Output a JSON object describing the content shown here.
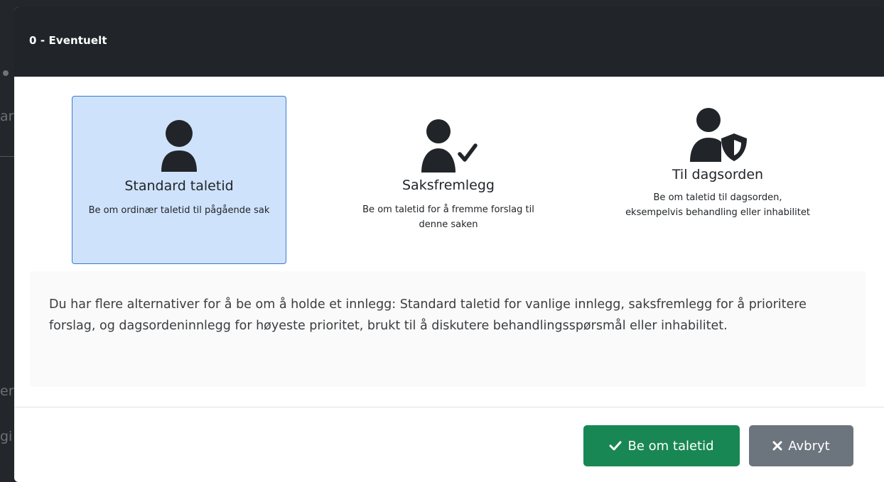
{
  "background": {
    "fragments": [
      "ar",
      "er",
      "gi"
    ]
  },
  "modal": {
    "title": "0 - Eventuelt"
  },
  "options": [
    {
      "icon": "user-icon",
      "title": "Standard taletid",
      "description": "Be om ordinær taletid til pågående sak",
      "selected": true
    },
    {
      "icon": "user-check-icon",
      "title": "Saksfremlegg",
      "description": "Be om taletid for å fremme forslag til denne saken",
      "selected": false
    },
    {
      "icon": "user-shield-icon",
      "title": "Til dagsorden",
      "description": "Be om taletid til dagsorden, eksempelvis behandling eller inhabilitet",
      "selected": false
    }
  ],
  "info": {
    "text": "Du har flere alternativer for å be om å holde et innlegg: Standard taletid for vanlige innlegg, saksfremlegg for å prioritere forslag, og dagsordeninnlegg for høyeste prioritet, brukt til å diskutere behandlingsspørsmål eller inhabilitet."
  },
  "footer": {
    "confirm_label": "Be om taletid",
    "confirm_icon": "check-icon",
    "cancel_label": "Avbryt",
    "cancel_icon": "close-icon"
  },
  "colors": {
    "header_bg": "#212529",
    "selected_bg": "#cfe2fb",
    "selected_border": "#3b7bd3",
    "confirm_bg": "#198754",
    "cancel_bg": "#6c757d"
  }
}
